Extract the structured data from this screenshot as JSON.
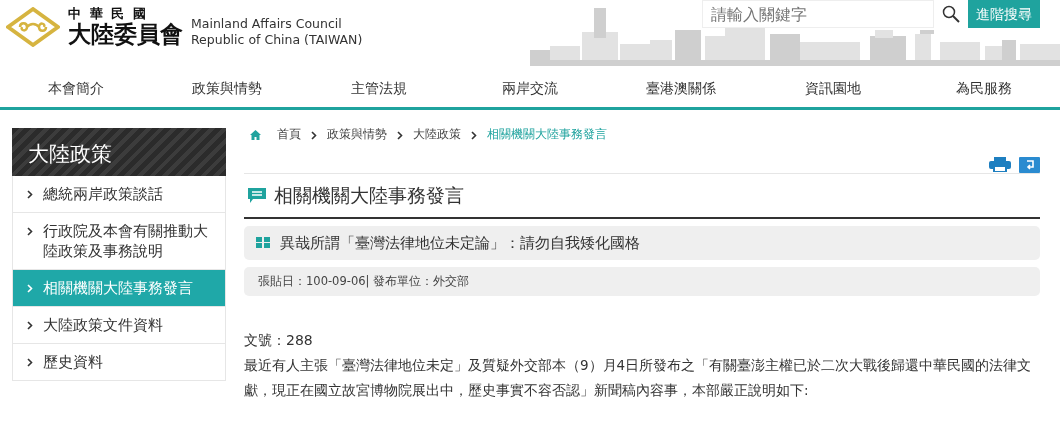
{
  "header": {
    "logo_title_top": "中 華 民 國",
    "logo_title_main": "大陸委員會",
    "logo_en_1": "Mainland Affairs Council",
    "logo_en_2": "Republic of China (TAIWAN)",
    "search": {
      "placeholder": "請輸入關鍵字"
    },
    "advanced_search": "進階搜尋"
  },
  "nav": [
    {
      "label": "本會簡介"
    },
    {
      "label": "政策與情勢"
    },
    {
      "label": "主管法規"
    },
    {
      "label": "兩岸交流"
    },
    {
      "label": "臺港澳關係"
    },
    {
      "label": "資訊園地"
    },
    {
      "label": "為民服務"
    }
  ],
  "sidebar": {
    "title": "大陸政策",
    "items": [
      {
        "label": "總統兩岸政策談話",
        "selected": false
      },
      {
        "label": "行政院及本會有關推動大陸政策及事務說明",
        "selected": false
      },
      {
        "label": "相關機關大陸事務發言",
        "selected": true
      },
      {
        "label": "大陸政策文件資料",
        "selected": false
      },
      {
        "label": "歷史資料",
        "selected": false
      }
    ]
  },
  "breadcrumb": [
    {
      "label": "首頁",
      "current": false
    },
    {
      "label": "政策與情勢",
      "current": false
    },
    {
      "label": "大陸政策",
      "current": false
    },
    {
      "label": "相關機關大陸事務發言",
      "current": true
    }
  ],
  "page_title": "相關機關大陸事務發言",
  "article": {
    "title": "異哉所謂「臺灣法律地位未定論」：請勿自我矮化國格",
    "meta": "張貼日：100-09-06| 發布單位：外交部",
    "number": "文號：288",
    "body": "最近有人主張「臺灣法律地位未定」及質疑外交部本（9）月4日所發布之「有關臺澎主權已於二次大戰後歸還中華民國的法律文獻，現正在國立故宮博物院展出中，歷史事實不容否認」新聞稿內容事，本部嚴正說明如下:"
  }
}
